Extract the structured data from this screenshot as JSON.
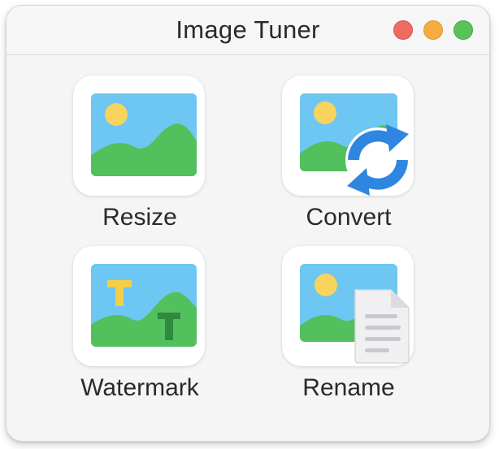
{
  "window": {
    "title": "Image Tuner",
    "controls": [
      "close",
      "minimize",
      "zoom"
    ]
  },
  "tools": [
    {
      "label": "Resize",
      "icon": "image-icon"
    },
    {
      "label": "Convert",
      "icon": "convert-refresh-icon"
    },
    {
      "label": "Watermark",
      "icon": "watermark-icon"
    },
    {
      "label": "Rename",
      "icon": "rename-document-icon"
    }
  ],
  "colors": {
    "sky": "#6ec6f2",
    "sun": "#f8d35e",
    "hills": "#53c05e",
    "refresh_arrow": "#2f86e0",
    "watermark_yellow": "#f2cf47",
    "watermark_green": "#2e8a3d"
  }
}
